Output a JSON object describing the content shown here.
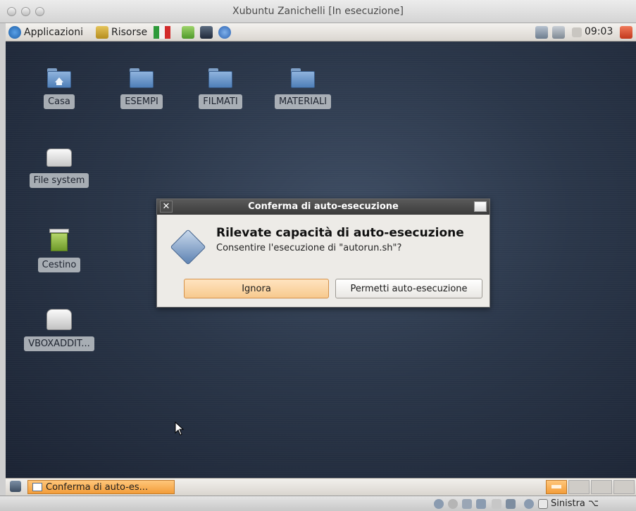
{
  "window": {
    "title": "Xubuntu Zanichelli [In esecuzione]"
  },
  "top_panel": {
    "applications": "Applicazioni",
    "resources": "Risorse",
    "clock": "09:03"
  },
  "desktop": {
    "icons": [
      {
        "label": "Casa",
        "type": "home-folder"
      },
      {
        "label": "ESEMPI",
        "type": "folder"
      },
      {
        "label": "FILMATI",
        "type": "folder"
      },
      {
        "label": "MATERIALI",
        "type": "folder"
      },
      {
        "label": "File system",
        "type": "drive"
      },
      {
        "label": "Cestino",
        "type": "trash"
      },
      {
        "label": "VBOXADDIT...",
        "type": "cdrom"
      }
    ]
  },
  "dialog": {
    "title": "Conferma di auto-esecuzione",
    "heading": "Rilevate capacità di auto-esecuzione",
    "message": "Consentire l'esecuzione di \"autorun.sh\"?",
    "ignore_button": "Ignora",
    "allow_button": "Permetti auto-esecuzione"
  },
  "bottom_panel": {
    "task": "Conferma di auto-es..."
  },
  "status_bar": {
    "host_key": "Sinistra ⌥"
  },
  "colors": {
    "desktop": "#2a3649",
    "dialog_title": "#3b3b3b",
    "accent_button": "#f7c98e"
  }
}
